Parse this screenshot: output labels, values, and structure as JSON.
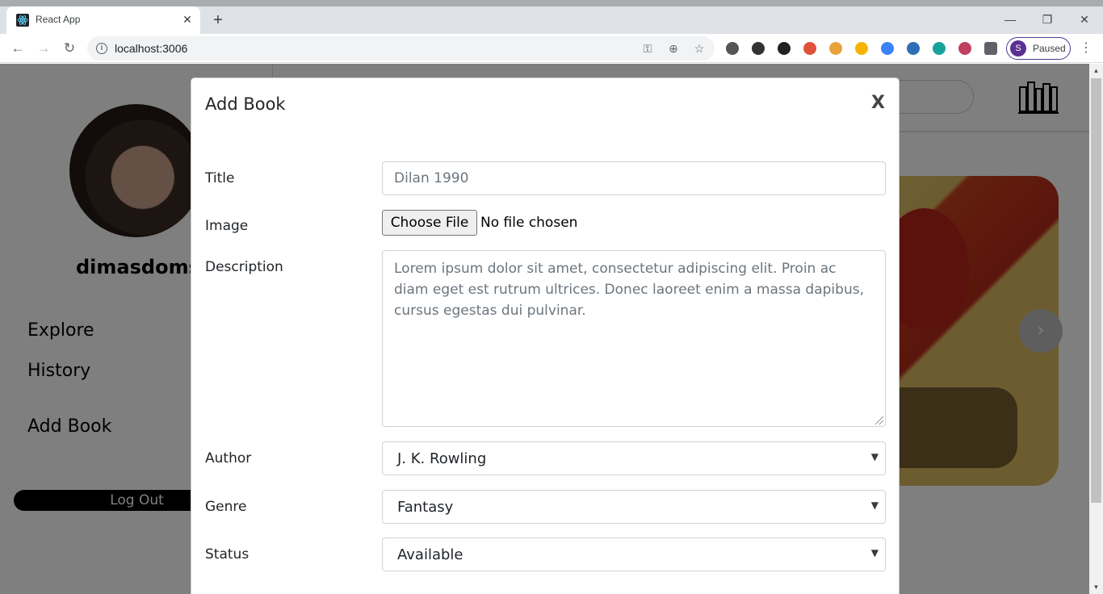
{
  "browser": {
    "tab_title": "React App",
    "tab_close": "✕",
    "new_tab": "+",
    "url": "localhost:3006",
    "profile_initial": "S",
    "profile_status": "Paused",
    "window_controls": {
      "minimize": "—",
      "restore": "❐",
      "close": "✕"
    },
    "nav": {
      "back": "←",
      "forward": "→",
      "reload": "↻"
    },
    "omnibox_icons": {
      "key": "⚿",
      "zoom": "⊕",
      "star": "☆"
    },
    "extensions": [
      {
        "name": "extension-gear-icon",
        "color": "#555555"
      },
      {
        "name": "extension-move-icon",
        "color": "#333333"
      },
      {
        "name": "extension-formula-icon",
        "color": "#222222"
      },
      {
        "name": "extension-colorwheel-icon",
        "color": "#e0513b"
      },
      {
        "name": "extension-calendar-icon",
        "color": "#e8a23a"
      },
      {
        "name": "extension-pma-icon",
        "color": "#f5b400"
      },
      {
        "name": "extension-globe-icon",
        "color": "#3b82f6"
      },
      {
        "name": "extension-compass-icon",
        "color": "#2f6fb5"
      },
      {
        "name": "extension-m-icon",
        "color": "#18a39a"
      },
      {
        "name": "extension-camera-icon",
        "color": "#c04060"
      },
      {
        "name": "extensions-puzzle-icon",
        "color": "#5f6368"
      }
    ]
  },
  "page": {
    "username": "dimasdoms",
    "nav": [
      "Explore",
      "History",
      "Add Book"
    ],
    "logout_label": "Log Out",
    "carousel_next": "›"
  },
  "modal": {
    "title": "Add Book",
    "close_label": "X",
    "fields": {
      "title_label": "Title",
      "title_value": "Dilan 1990",
      "image_label": "Image",
      "file_button": "Choose File",
      "file_status": "No file chosen",
      "description_label": "Description",
      "description_value": "Lorem ipsum dolor sit amet, consectetur adipiscing elit. Proin ac diam eget est rutrum ultrices. Donec laoreet enim a massa dapibus, cursus egestas dui pulvinar.",
      "author_label": "Author",
      "author_value": "J. K. Rowling",
      "genre_label": "Genre",
      "genre_value": "Fantasy",
      "status_label": "Status",
      "status_value": "Available"
    },
    "chevron": "⌄"
  },
  "scrollbar": {
    "up": "▲",
    "down": "▼"
  }
}
